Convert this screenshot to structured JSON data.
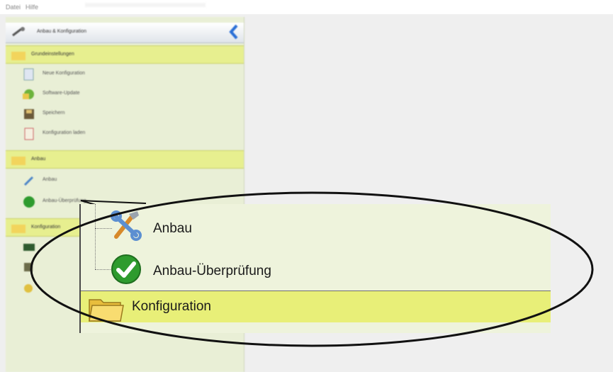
{
  "menubar": {
    "items": [
      "Datei",
      "Hilfe"
    ]
  },
  "sidebar": {
    "header_label": "Anbau & Konfiguration",
    "groups": [
      {
        "label": "Grundeinstellungen"
      },
      {
        "label": "Anbau"
      },
      {
        "label": "Konfiguration"
      }
    ],
    "items_group1": [
      {
        "label": "Neue Konfiguration",
        "icon": "document-icon"
      },
      {
        "label": "Software-Update",
        "icon": "update-icon"
      },
      {
        "label": "Speichern",
        "icon": "save-icon"
      },
      {
        "label": "Konfiguration laden",
        "icon": "open-file-icon"
      }
    ],
    "items_group2": [
      {
        "label": "Anbau",
        "icon": "wrench-icon"
      },
      {
        "label": "Anbau-Überprüfung",
        "icon": "check-icon"
      }
    ]
  },
  "zoom": {
    "items": [
      {
        "label": "Anbau",
        "icon": "wrench-screwdriver-icon"
      },
      {
        "label": "Anbau-Überprüfung",
        "icon": "green-check-icon"
      }
    ],
    "group_label": "Konfiguration",
    "group_icon": "folder-icon"
  },
  "colors": {
    "group_bg": "#e8ef78",
    "panel_bg": "#eef3dc",
    "check_green": "#2e9b2e",
    "folder_yellow": "#f2d45c"
  }
}
